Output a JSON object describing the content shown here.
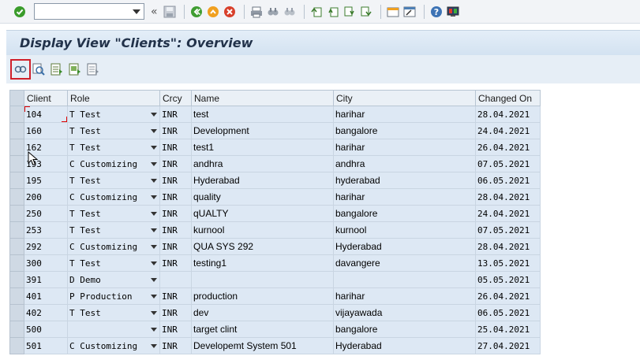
{
  "system_toolbar": {
    "command_field_value": "",
    "icons": [
      "enter-icon",
      "save-icon",
      "back-icon",
      "exit-icon",
      "cancel-icon",
      "print-icon",
      "find-icon",
      "find-next-icon",
      "first-page-icon",
      "previous-page-icon",
      "next-page-icon",
      "last-page-icon",
      "create-session-icon",
      "shortcut-icon",
      "help-icon",
      "customize-layout-icon"
    ]
  },
  "title": "Display View \"Clients\": Overview",
  "app_toolbar": {
    "icons": [
      "display-details-icon",
      "find-icon",
      "select-all-icon",
      "select-block-icon",
      "deselect-all-icon"
    ]
  },
  "table": {
    "columns": [
      "Client",
      "Role",
      "Crcy",
      "Name",
      "City",
      "Changed On"
    ],
    "rows": [
      {
        "client": "104",
        "role": "T Test",
        "crcy": "INR",
        "name": "test",
        "city": "harihar",
        "changed_on": "28.04.2021"
      },
      {
        "client": "160",
        "role": "T Test",
        "crcy": "INR",
        "name": "Development",
        "city": "bangalore",
        "changed_on": "24.04.2021"
      },
      {
        "client": "162",
        "role": "T Test",
        "crcy": "INR",
        "name": "test1",
        "city": "harihar",
        "changed_on": "26.04.2021"
      },
      {
        "client": "193",
        "role": "C Customizing",
        "crcy": "INR",
        "name": "andhra",
        "city": "andhra",
        "changed_on": "07.05.2021"
      },
      {
        "client": "195",
        "role": "T Test",
        "crcy": "INR",
        "name": "Hyderabad",
        "city": "hyderabad",
        "changed_on": "06.05.2021"
      },
      {
        "client": "200",
        "role": "C Customizing",
        "crcy": "INR",
        "name": "quality",
        "city": "harihar",
        "changed_on": "28.04.2021"
      },
      {
        "client": "250",
        "role": "T Test",
        "crcy": "INR",
        "name": "qUALTY",
        "city": "bangalore",
        "changed_on": "24.04.2021"
      },
      {
        "client": "253",
        "role": "T Test",
        "crcy": "INR",
        "name": "kurnool",
        "city": "kurnool",
        "changed_on": "07.05.2021"
      },
      {
        "client": "292",
        "role": "C Customizing",
        "crcy": "INR",
        "name": "QUA SYS 292",
        "city": "Hyderabad",
        "changed_on": "28.04.2021"
      },
      {
        "client": "300",
        "role": "T Test",
        "crcy": "INR",
        "name": "testing1",
        "city": "davangere",
        "changed_on": "13.05.2021"
      },
      {
        "client": "391",
        "role": "D Demo",
        "crcy": "",
        "name": "",
        "city": "",
        "changed_on": "05.05.2021"
      },
      {
        "client": "401",
        "role": "P Production",
        "crcy": "INR",
        "name": "production",
        "city": "harihar",
        "changed_on": "26.04.2021"
      },
      {
        "client": "402",
        "role": "T Test",
        "crcy": "INR",
        "name": "dev",
        "city": "vijayawada",
        "changed_on": "06.05.2021"
      },
      {
        "client": "500",
        "role": "",
        "crcy": "INR",
        "name": "target clint",
        "city": "bangalore",
        "changed_on": "25.04.2021"
      },
      {
        "client": "501",
        "role": "C Customizing",
        "crcy": "INR",
        "name": "Developemt System 501",
        "city": "Hyderabad",
        "changed_on": "27.04.2021"
      }
    ]
  },
  "colors": {
    "title_bg": "#d3e2f1",
    "row_bg": "#dde8f4",
    "highlight_red": "#d0202a"
  }
}
